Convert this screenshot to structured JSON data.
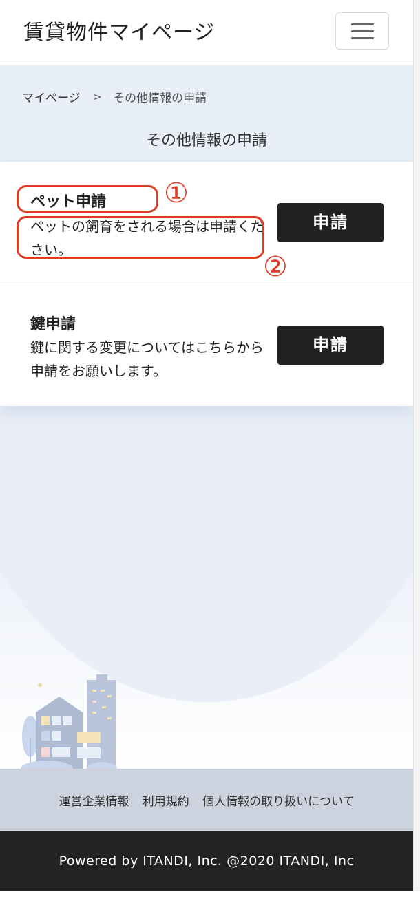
{
  "header": {
    "title": "賃貸物件マイページ",
    "menu_icon": "hamburger-menu-icon"
  },
  "breadcrumb": {
    "home": "マイページ",
    "separator": ">",
    "current": "その他情報の申請"
  },
  "page_title": "その他情報の申請",
  "cards": [
    {
      "title": "ペット申請",
      "description": "ペットの飼育をされる場合は申請ください。",
      "button": "申請"
    },
    {
      "title": "鍵申請",
      "description": "鍵に関する変更についてはこちらから申請をお願いします。",
      "button": "申請"
    }
  ],
  "annotations": {
    "one": "①",
    "two": "②",
    "color": "#e03c24"
  },
  "footer": {
    "links": [
      "運営企業情報",
      "利用規約",
      "個人情報の取り扱いについて"
    ],
    "copyright": "Powered by ITANDI, Inc. @2020 ITANDI, Inc"
  },
  "colors": {
    "accent": "#222222",
    "band": "#e9eff8",
    "footer_links_bg": "#ccd3de",
    "footer_bg": "#232323"
  }
}
